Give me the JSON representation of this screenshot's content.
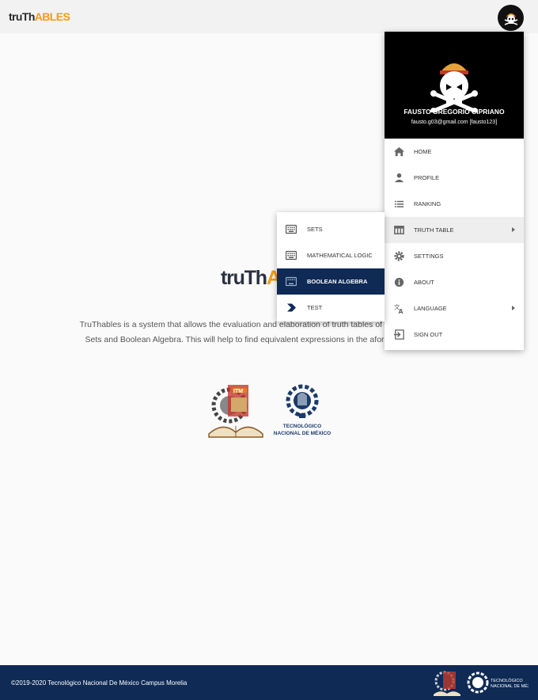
{
  "app": {
    "logo_part1": "truTh",
    "logo_part2": "ABLES"
  },
  "main": {
    "logo_part1": "truTh",
    "logo_part2": "A",
    "description": "TruThables is a system that allows the evaluation and elaboration of truth tables of mathematical Logic, Sets and Boolean Algebra. This will help to find equivalent expressions in the aforementioned areas.",
    "logos": [
      "itm-logo",
      "tecnm-logo"
    ]
  },
  "profile_menu": {
    "user_name": "FAUSTO GREGORIO CIPRIANO",
    "user_email": "fausto.g03@gmail.com [fausto123]",
    "items": [
      {
        "label": "HOME",
        "icon": "home-icon"
      },
      {
        "label": "PROFILE",
        "icon": "person-icon"
      },
      {
        "label": "RANKING",
        "icon": "list-icon"
      },
      {
        "label": "TRUTH TABLE",
        "icon": "table-icon",
        "has_submenu": true,
        "active": true
      },
      {
        "label": "SETTINGS",
        "icon": "gear-icon"
      },
      {
        "label": "ABOUT",
        "icon": "info-icon"
      },
      {
        "label": "LANGUAGE",
        "icon": "translate-icon",
        "has_submenu": true
      },
      {
        "label": "SIGN OUT",
        "icon": "sign-out-icon"
      }
    ]
  },
  "truth_table_submenu": {
    "items": [
      {
        "label": "SETS",
        "icon": "keyboard-icon"
      },
      {
        "label": "MATHEMATICAL LOGIC",
        "icon": "keyboard-icon"
      },
      {
        "label": "BOOLEAN ALGEBRA",
        "icon": "keyboard-icon",
        "selected": true
      },
      {
        "label": "TEST",
        "icon": "chevron-right-icon"
      }
    ]
  },
  "footer": {
    "copyright": "©2019-2020 Tecnológico Nacional De México Campus Morelia"
  },
  "colors": {
    "primary": "#0e2a55",
    "accent": "#f59a16",
    "header_bg": "#000000"
  }
}
